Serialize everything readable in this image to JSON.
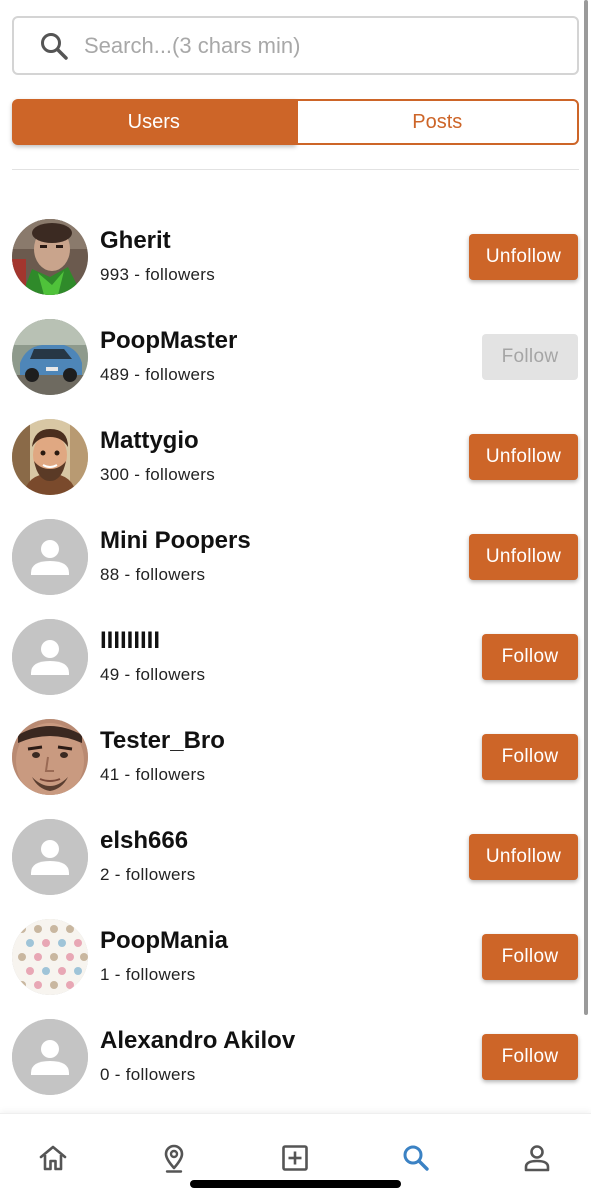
{
  "search": {
    "placeholder": "Search...(3 chars min)",
    "value": ""
  },
  "tabs": [
    {
      "label": "Users",
      "active": true
    },
    {
      "label": "Posts",
      "active": false
    }
  ],
  "users": [
    {
      "name": "Gherit",
      "followers": "993 - followers",
      "button": "Unfollow",
      "button_state": "unfollow",
      "avatar": "photo-person-green"
    },
    {
      "name": "PoopMaster",
      "followers": "489 - followers",
      "button": "Follow",
      "button_state": "disabled",
      "avatar": "photo-blue-car"
    },
    {
      "name": "Mattygio",
      "followers": "300 - followers",
      "button": "Unfollow",
      "button_state": "unfollow",
      "avatar": "cartoon-bearded-man"
    },
    {
      "name": "Mini Poopers",
      "followers": "88 - followers",
      "button": "Unfollow",
      "button_state": "unfollow",
      "avatar": "default-avatar"
    },
    {
      "name": "IIIIIIIII",
      "followers": "49 - followers",
      "button": "Follow",
      "button_state": "follow",
      "avatar": "default-avatar"
    },
    {
      "name": "Tester_Bro",
      "followers": "41 - followers",
      "button": "Follow",
      "button_state": "follow",
      "avatar": "photo-face-closeup"
    },
    {
      "name": "elsh666",
      "followers": "2 - followers",
      "button": "Unfollow",
      "button_state": "unfollow",
      "avatar": "default-avatar"
    },
    {
      "name": "PoopMania",
      "followers": "1 - followers",
      "button": "Follow",
      "button_state": "follow",
      "avatar": "pattern-poop-icons"
    },
    {
      "name": "Alexandro Akilov",
      "followers": "0 - followers",
      "button": "Follow",
      "button_state": "follow",
      "avatar": "default-avatar"
    }
  ],
  "bottom_nav": [
    {
      "icon": "home-icon",
      "active": false
    },
    {
      "icon": "map-pin-icon",
      "active": false
    },
    {
      "icon": "add-square-icon",
      "active": false
    },
    {
      "icon": "search-icon",
      "active": true
    },
    {
      "icon": "profile-icon",
      "active": false
    }
  ],
  "colors": {
    "accent": "#cd6528",
    "active_nav": "#3b82c4",
    "disabled_bg": "#e3e3e3",
    "avatar_placeholder": "#c4c4c4"
  }
}
